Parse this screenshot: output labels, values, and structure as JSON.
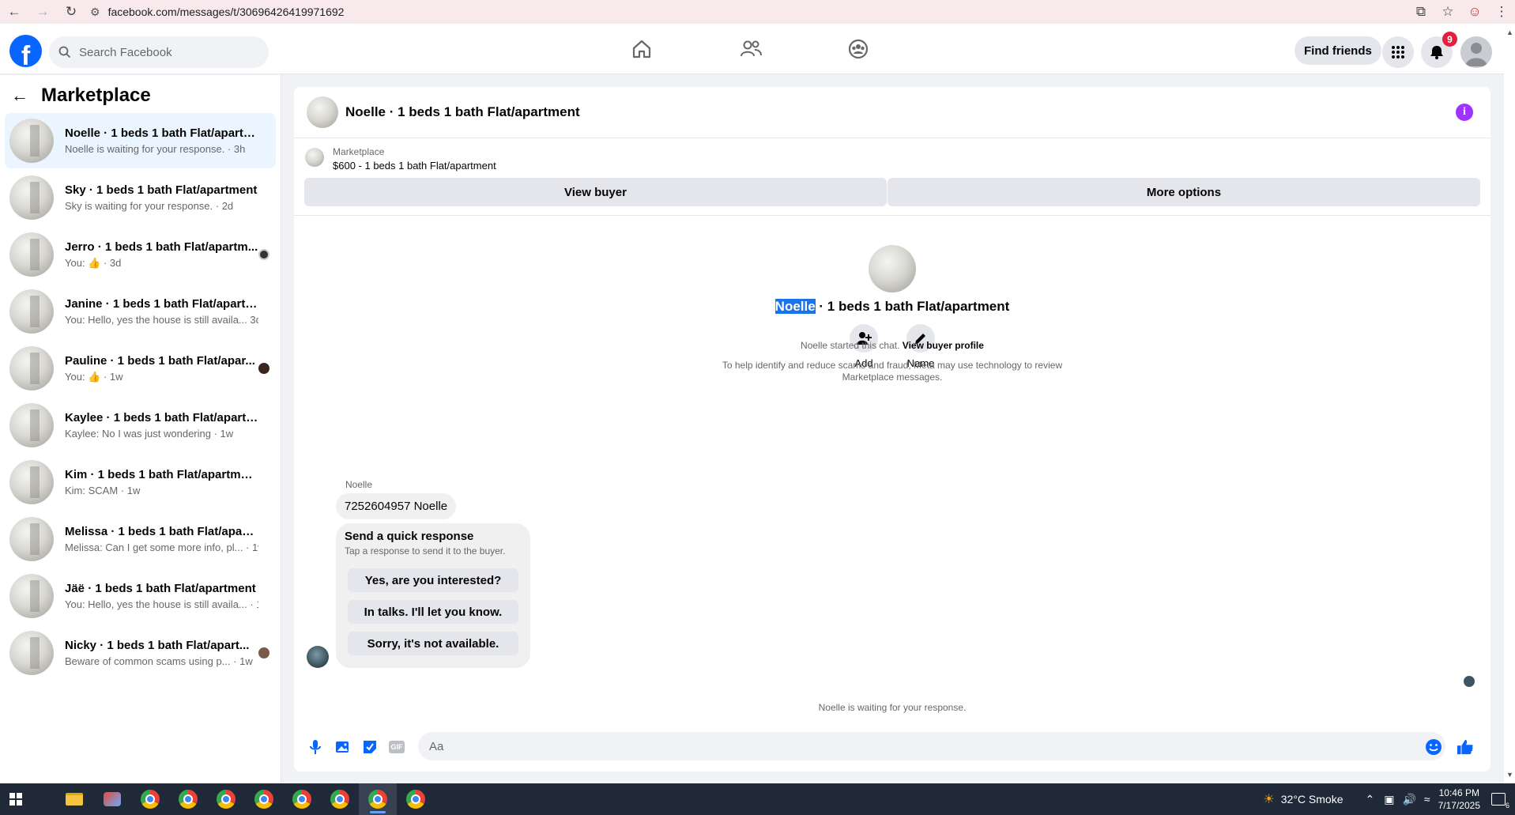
{
  "browser": {
    "url": "facebook.com/messages/t/30696426419971692"
  },
  "header": {
    "logo": "f",
    "search_placeholder": "Search Facebook",
    "find_friends": "Find friends",
    "notification_count": "9"
  },
  "sidebar": {
    "title": "Marketplace",
    "conversations": [
      {
        "name": "Noelle · 1 beds 1 bath Flat/apartm...",
        "sub": "Noelle is waiting for your response. · 3h"
      },
      {
        "name": "Sky · 1 beds 1 bath Flat/apartment",
        "sub": "Sky is waiting for your response. · 2d"
      },
      {
        "name": "Jerro · 1 beds 1 bath Flat/apartm...",
        "sub": "You: 👍 · 3d"
      },
      {
        "name": "Janine · 1 beds 1 bath Flat/apartme...",
        "sub": "You: Hello, yes the house is still availa...   3d"
      },
      {
        "name": "Pauline · 1 beds 1 bath Flat/apar...",
        "sub": "You: 👍 · 1w"
      },
      {
        "name": "Kaylee · 1 beds 1 bath Flat/apartm...",
        "sub": "Kaylee: No I was just wondering · 1w"
      },
      {
        "name": "Kim · 1 beds 1 bath Flat/apartment",
        "sub": "Kim: SCAM · 1w"
      },
      {
        "name": "Melissa · 1 beds 1 bath Flat/apartm...",
        "sub": "Melissa: Can I get some more info, pl...  · 1w"
      },
      {
        "name": "Jäë · 1 beds 1 bath Flat/apartment",
        "sub": "You: Hello, yes the house is still availa...  · 1w"
      },
      {
        "name": "Nicky · 1 beds 1 bath Flat/apart...",
        "sub": "Beware of common scams using p...  · 1w"
      }
    ]
  },
  "chat": {
    "title": "Noelle · 1 beds 1 bath Flat/apartment",
    "listing_label": "Marketplace",
    "listing_price": "$600 - 1 beds 1 bath Flat/apartment",
    "view_buyer": "View buyer",
    "more_options": "More options",
    "profile_name_highlight": "Noelle",
    "profile_name_rest": " · 1 beds 1 bath Flat/apartment",
    "action_add": "Add",
    "action_name": "Name",
    "started_text": "Noelle started this chat. ",
    "view_buyer_profile": "View buyer profile",
    "scam_notice_line1": "To help identify and reduce scams and fraud, Meta may use technology to review",
    "scam_notice_line2": "Marketplace messages.",
    "sender": "Noelle",
    "message": "7252604957 Noelle",
    "quick_title": "Send a quick response",
    "quick_sub": "Tap a response to send it to the buyer.",
    "quick_options": [
      "Yes, are you interested?",
      "In talks. I'll let you know.",
      "Sorry, it's not available."
    ],
    "waiting_text": "Noelle is waiting for your response.",
    "input_placeholder": "Aa"
  },
  "taskbar": {
    "weather": "32°C  Smoke",
    "time": "10:46 PM",
    "date": "7/17/2025",
    "notif_count": "6"
  },
  "colors": {
    "fb_blue": "#0866ff",
    "info_purple": "#a033ff",
    "badge_red": "#e41e3f"
  }
}
